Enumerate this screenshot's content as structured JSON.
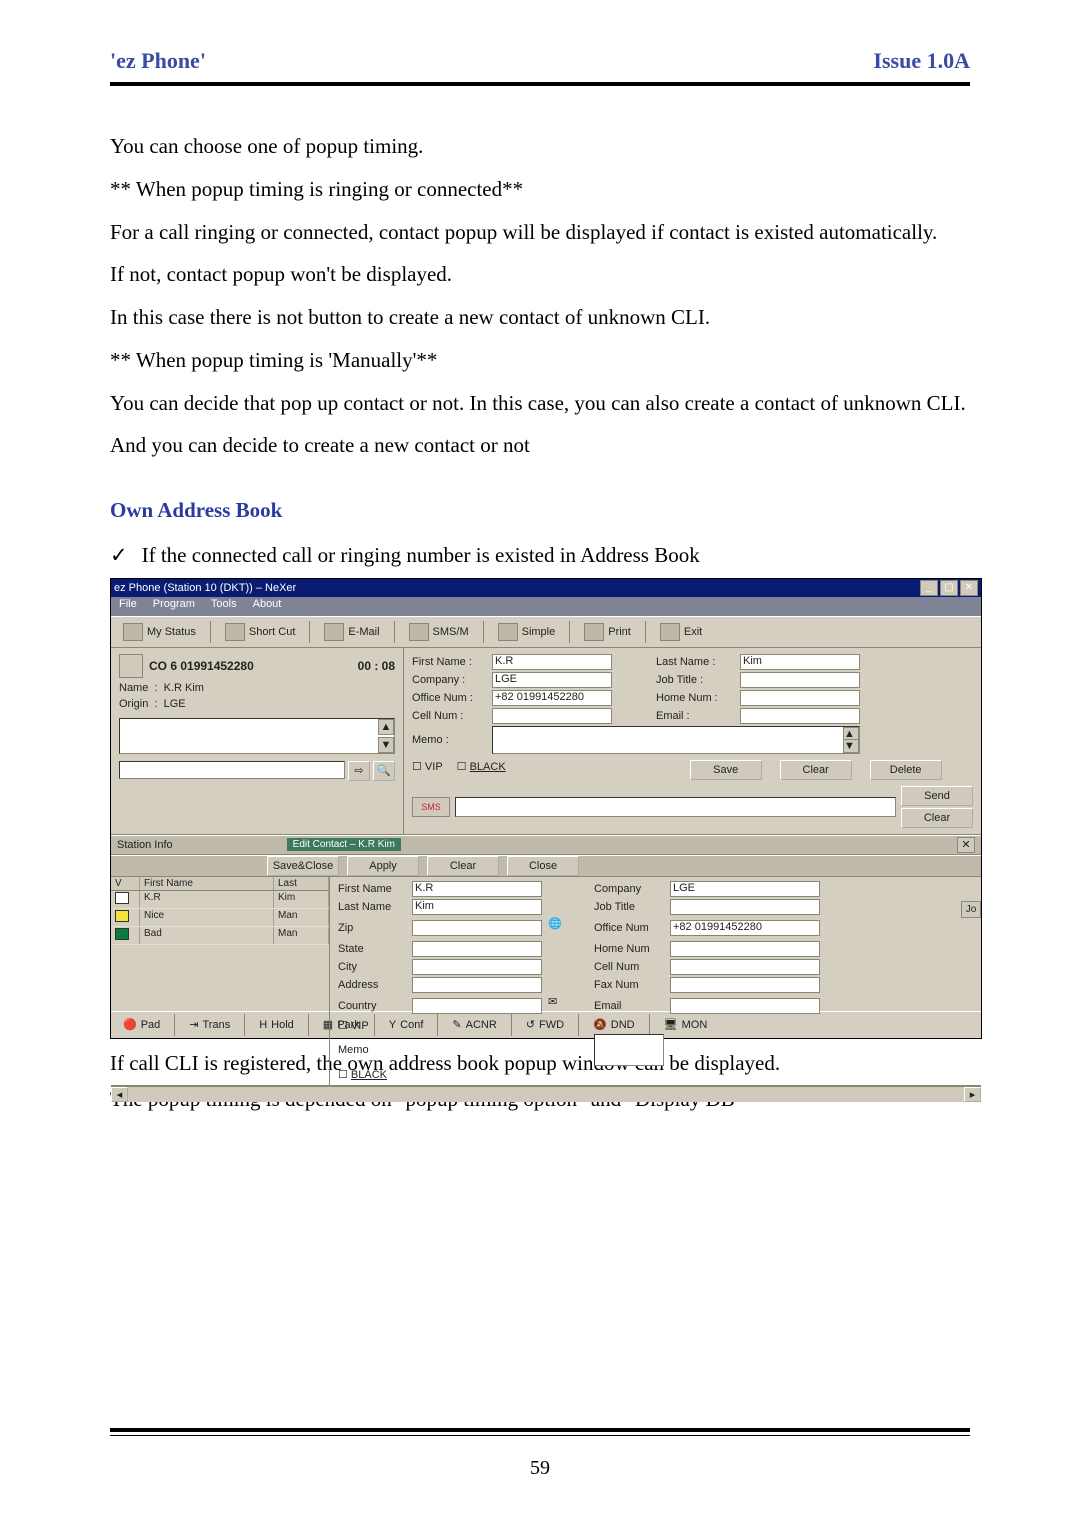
{
  "header": {
    "left": "'ez Phone'",
    "right": "Issue 1.0A"
  },
  "paragraphs": {
    "p1": "You can choose one of popup timing.",
    "p2": "** When popup timing is ringing or connected**",
    "p3": "For a call ringing or connected, contact popup will be displayed if contact is existed automatically.",
    "p4": "If not, contact popup won't be displayed.",
    "p5": "In this case there is not button to create a new contact of unknown CLI.",
    "p6": "** When popup timing is 'Manually'**",
    "p7": "You can decide that pop up contact or not. In this case, you can also create a contact of unknown CLI.",
    "p8": "And you can decide to create a new contact or not"
  },
  "section_title": "Own Address Book",
  "check_line": "If the connected call or ringing number is existed in Address Book",
  "app": {
    "title": "ez Phone (Station 10 (DKT)) – NeXer",
    "window_buttons": {
      "min": "_",
      "max": "▢",
      "close": "✕"
    },
    "menu": [
      "File",
      "Program",
      "Tools",
      "About"
    ],
    "toolbar": [
      "My Status",
      "Short Cut",
      "E-Mail",
      "SMS/M",
      "Simple",
      "Print",
      "Exit"
    ],
    "call": {
      "line": "CO  6 01991452280",
      "timer": "00 : 08",
      "name_label": "Name",
      "name_value": "K.R Kim",
      "origin_label": "Origin",
      "origin_value": "LGE",
      "go_icon": "⇨",
      "search_icon": "🔍"
    },
    "contact": {
      "first_name_l": "First Name :",
      "first_name_v": "K.R",
      "last_name_l": "Last Name :",
      "last_name_v": "Kim",
      "company_l": "Company   :",
      "company_v": "LGE",
      "job_title_l": "Job Title    :",
      "job_title_v": "",
      "office_l": "Office Num :",
      "office_v": "+82 01991452280",
      "home_l": "Home Num :",
      "home_v": "",
      "cell_l": "Cell Num   :",
      "cell_v": "",
      "email_l": "Email        :",
      "email_v": "",
      "memo_l": "Memo       :",
      "vip": "VIP",
      "black": "BLACK",
      "btn_save": "Save",
      "btn_clear": "Clear",
      "btn_delete": "Delete",
      "sms_label": "SMS",
      "btn_send": "Send",
      "btn_clear2": "Clear"
    },
    "station": {
      "label": "Station Info",
      "green_tab": "Edit Contact – K.R Kim",
      "btn_saveclose": "Save&Close",
      "btn_apply": "Apply",
      "btn_clear": "Clear",
      "btn_close": "Close",
      "close_x": "✕"
    },
    "list": {
      "headers": {
        "v": "V",
        "first": "First Name",
        "last": "Last"
      },
      "rows": [
        {
          "icon": "plain",
          "first": "K.R",
          "last": "Kim"
        },
        {
          "icon": "y",
          "first": "Nice",
          "last": "Man"
        },
        {
          "icon": "b",
          "first": "Bad",
          "last": "Man"
        }
      ]
    },
    "edit": {
      "first_l": "First Name",
      "first_v": "K.R",
      "last_l": "Last Name",
      "last_v": "Kim",
      "company_l": "Company",
      "company_v": "LGE",
      "job_l": "Job Title",
      "job_v": "",
      "zip_l": "Zip",
      "state_l": "State",
      "city_l": "City",
      "address_l": "Address",
      "country_l": "Country",
      "office_l": "Office Num",
      "office_v": "+82 01991452280",
      "home_l": "Home Num",
      "cell_l": "Cell Num",
      "fax_l": "Fax Num",
      "email_l": "Email",
      "vip": "VIP",
      "black": "BLACK",
      "memo_l": "Memo",
      "jo": "Jo"
    },
    "footer": [
      "Pad",
      "Trans",
      "Hold",
      "Park",
      "Conf",
      "ACNR",
      "FWD",
      "DND",
      "MON"
    ],
    "footer_icons": [
      "🔴",
      "⇥",
      "H",
      "▦",
      "Y",
      "✎",
      "↺",
      "🔕",
      "🖥"
    ]
  },
  "post1": "If call CLI is registered, the own address book popup window can be displayed.",
  "post2a": "The popup timing is depended on \"popup timing option\" and \"",
  "post2b": "Display DB",
  "post2c": "\"",
  "page_number": "59"
}
